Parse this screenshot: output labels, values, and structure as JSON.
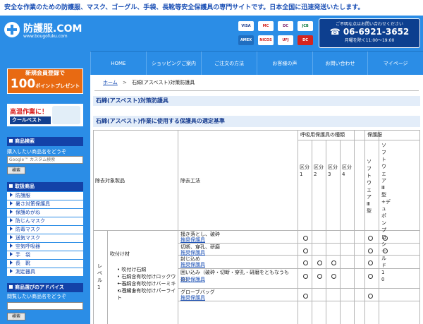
{
  "tagline": "安全な作業のための防護服、マスク、ゴーグル、手袋、長靴等安全保護具の専門サイトです。日本全国に迅速発送いたします。",
  "logo": {
    "title": "防護服.COM",
    "url": "www.bougofuku.com"
  },
  "payment_cards": [
    "VISA",
    "MC",
    "DC",
    "JCB",
    "AMEX",
    "NICOS",
    "UFJ",
    "DC"
  ],
  "contact": {
    "caption": "ご不明な点はお問い合わせください",
    "tel": "06-6921-3652",
    "hours": "月曜を除く11:00～19:00"
  },
  "nav": [
    "HOME",
    "ショッピングご案内",
    "ご注文の方法",
    "お客様の声",
    "お問い合わせ",
    "マイページ"
  ],
  "sidebar": {
    "register_banner": {
      "line1": "新規会員登録で",
      "points": "100",
      "points_suffix": "ポイントプレゼント"
    },
    "heat_banner": {
      "line1": "高温作業に！",
      "line2": "クールベスト"
    },
    "search": {
      "heading": "商品検索",
      "note": "購入したい商品名をどうぞ",
      "placeholder": "Google™ カスタム検索",
      "button": "検索"
    },
    "categories_heading": "取扱商品",
    "categories": [
      "防護服",
      "暑さ対策保護具",
      "保護めがね",
      "防じんマスク",
      "防毒マスク",
      "送気マスク",
      "空気呼吸器",
      "手　袋",
      "長　靴",
      "測定器具"
    ],
    "advice": {
      "heading": "商品選びのアドバイス",
      "note": "閲覧したい商品名をどうぞ",
      "button": "検索"
    }
  },
  "main": {
    "breadcrumb": {
      "home": "ホーム",
      "current": "石綿(アスベスト)対策防護具"
    },
    "title": "石綿(アスベスト)対策防護具",
    "subtitle": "石綿(アスベスト)作業に使用する保護具の選定基準",
    "table": {
      "h_products": "除去対象製品",
      "h_method": "除去工法",
      "h_resp": "呼吸用保護具の種類",
      "h_suit": "保護服",
      "resp_cols": [
        "区分1",
        "区分2",
        "区分3",
        "区分4"
      ],
      "suit_cols": [
        "ソフトウェアⅢ型",
        "ソフトウェアⅢ型+デュポンプロシールド10"
      ],
      "level": "レベル1",
      "product_group": "吹付け材",
      "product_items": [
        "吹付け石綿",
        "石綿含有吹付けロックウール",
        "石綿含有吹付けバーミキュライト",
        "石綿含有吹付けパーライト"
      ],
      "rows": [
        {
          "method": "掻き落とし、破砕",
          "link": "推奨保護具",
          "marks": [
            1,
            0,
            0,
            0,
            1,
            1
          ]
        },
        {
          "method": "切断、穿孔、研磨",
          "link": "推奨保護具",
          "marks": [
            1,
            0,
            0,
            0,
            1,
            1
          ]
        },
        {
          "method": "封じ込め",
          "link": "推奨保護具",
          "marks": [
            1,
            1,
            1,
            0,
            1,
            0
          ]
        },
        {
          "method": "囲い込み（破砕・切断・穿孔・研磨をともなうもの）",
          "link": "推奨保護具",
          "marks": [
            1,
            1,
            1,
            0,
            1,
            0
          ]
        },
        {
          "method": "グローブバッグ",
          "link": "推奨保護具",
          "marks": [
            1,
            0,
            0,
            0,
            1,
            0
          ]
        }
      ]
    }
  },
  "colors": {
    "header_blue": "#2b8de6",
    "nav_dark": "#1342a8",
    "orange": "#e86a12",
    "title_bg": "#e3edf9",
    "link": "#1a4fb5"
  }
}
